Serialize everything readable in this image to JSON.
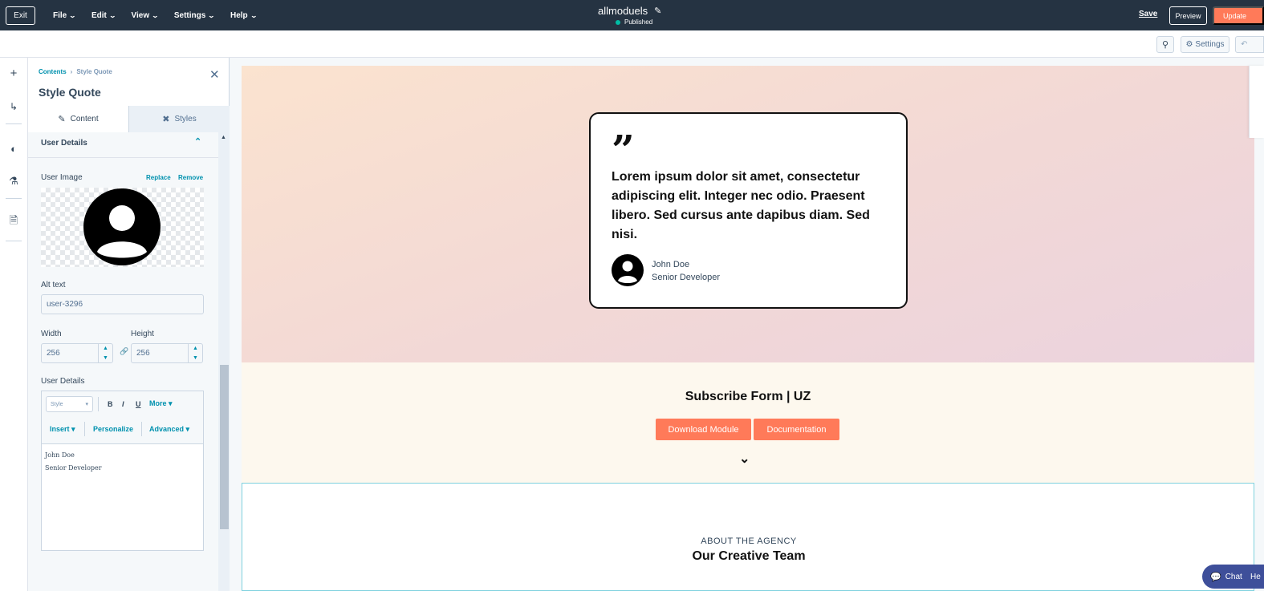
{
  "topbar": {
    "exit_label": "Exit",
    "menu": [
      {
        "label": "File"
      },
      {
        "label": "Edit"
      },
      {
        "label": "View"
      },
      {
        "label": "Settings"
      },
      {
        "label": "Help"
      }
    ],
    "site_title": "allmoduels",
    "status": "Published",
    "save_label": "Save",
    "preview_label": "Preview",
    "update_label": "Update"
  },
  "subbar": {
    "settings_label": "Settings"
  },
  "panel": {
    "breadcrumb": {
      "root": "Contents",
      "current": "Style Quote"
    },
    "title": "Style Quote",
    "tabs": {
      "content": "Content",
      "styles": "Styles"
    },
    "section_label": "User Details",
    "user_image": {
      "label": "User Image",
      "replace": "Replace",
      "remove": "Remove"
    },
    "alt_text": {
      "label": "Alt text",
      "value": "user-3296"
    },
    "width": {
      "label": "Width",
      "value": "256"
    },
    "height": {
      "label": "Height",
      "value": "256"
    },
    "user_details_label": "User Details",
    "editor": {
      "style_placeholder": "Style",
      "bold": "B",
      "italic": "I",
      "underline": "U",
      "more": "More",
      "insert": "Insert",
      "personalize": "Personalize",
      "advanced": "Advanced",
      "lines": [
        "John Doe",
        "Senior Developer"
      ]
    }
  },
  "canvas": {
    "quote": {
      "text": "Lorem ipsum dolor sit amet, consectetur adipiscing elit. Integer nec odio. Praesent libero. Sed cursus ante dapibus diam. Sed nisi.",
      "name": "John Doe",
      "role": "Senior Developer"
    },
    "subscribe": {
      "title": "Subscribe Form | UZ",
      "download_label": "Download Module",
      "docs_label": "Documentation"
    },
    "about": {
      "kicker": "ABOUT THE AGENCY",
      "title": "Our Creative Team"
    }
  },
  "chat": {
    "label": "Chat",
    "help": "He"
  },
  "colors": {
    "topbar": "#253342",
    "accent_orange": "#ff7a59",
    "link_teal": "#0091ae",
    "status_green": "#00bda5"
  }
}
